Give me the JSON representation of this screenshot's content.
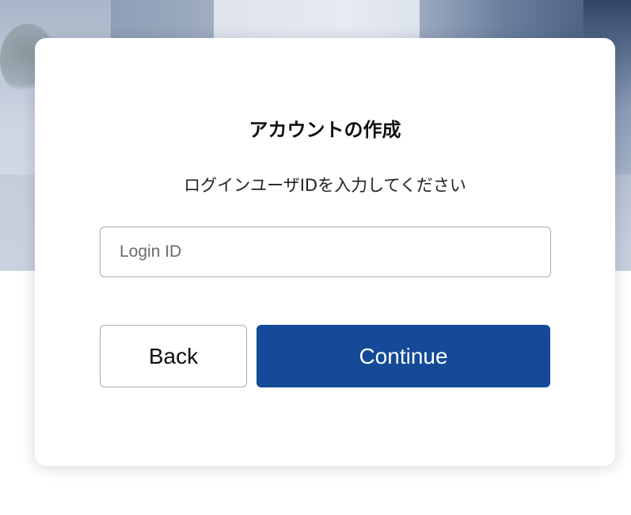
{
  "dialog": {
    "title": "アカウントの作成",
    "subtitle": "ログインユーザIDを入力してください"
  },
  "form": {
    "login_id": {
      "value": "",
      "placeholder": "Login ID"
    }
  },
  "buttons": {
    "back_label": "Back",
    "continue_label": "Continue"
  },
  "colors": {
    "primary": "#144a97",
    "card_background": "#ffffff",
    "border": "#a8abb3"
  }
}
